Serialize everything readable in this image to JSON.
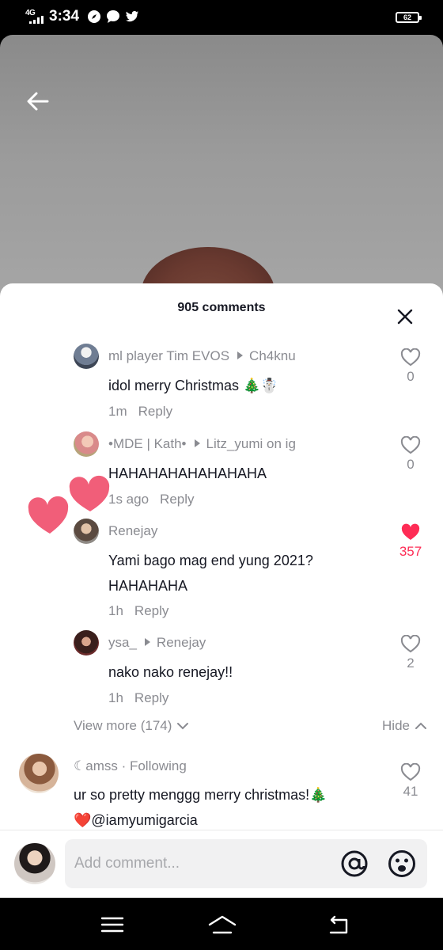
{
  "status_bar": {
    "network": "4G",
    "time": "3:34",
    "battery": "62",
    "icons": [
      "compass-icon",
      "chat-bubble-icon",
      "twitter-icon"
    ]
  },
  "sheet": {
    "title": "905 comments"
  },
  "comments": [
    {
      "user": "ml player Tim EVOS",
      "reply_to": "Ch4knu",
      "text_lines": [
        "idol merry Christmas 🎄☃️"
      ],
      "time": "1m",
      "reply_label": "Reply",
      "likes": "0",
      "liked": false
    },
    {
      "user": "•MDE | Kath•",
      "reply_to": "Litz_yumi on ig",
      "text_lines": [
        "HAHAHAHAHAHAHAHA"
      ],
      "time": "1s ago",
      "reply_label": "Reply",
      "likes": "0",
      "liked": false
    },
    {
      "user": "Renejay",
      "reply_to": "",
      "text_lines": [
        "Yami bago mag end yung 2021?",
        "HAHAHAHA"
      ],
      "time": "1h",
      "reply_label": "Reply",
      "likes": "357",
      "liked": true
    },
    {
      "user": "ysa_",
      "reply_to": "Renejay",
      "text_lines": [
        "nako nako renejay!!"
      ],
      "time": "1h",
      "reply_label": "Reply",
      "likes": "2",
      "liked": false
    },
    {
      "user": "☾amss · Following",
      "reply_to": "",
      "text_lines": [
        "ur so pretty menggg merry christmas!🎄",
        "❤️@iamyumigarcia"
      ],
      "time": "",
      "reply_label": "",
      "likes": "41",
      "liked": false
    }
  ],
  "thread": {
    "view_more": "View more (174)",
    "hide": "Hide"
  },
  "input": {
    "placeholder": "Add comment..."
  },
  "colors": {
    "accent": "#fe2c55",
    "text_primary": "#161823",
    "text_secondary": "#8a8b91",
    "heart_float": "#f0506e"
  }
}
